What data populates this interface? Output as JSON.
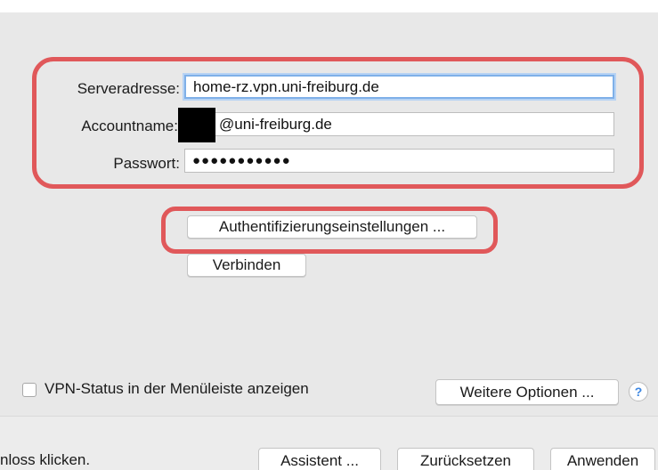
{
  "form": {
    "server_label": "Serveradresse:",
    "server_value": "home-rz.vpn.uni-freiburg.de",
    "account_label": "Accountname:",
    "account_value": "@uni-freiburg.de",
    "password_label": "Passwort:",
    "password_value": "●●●●●●●●●●●"
  },
  "buttons": {
    "auth_settings": "Authentifizierungseinstellungen ...",
    "connect": "Verbinden",
    "more_options": "Weitere Optionen ...",
    "assistant": "Assistent ...",
    "reset": "Zurücksetzen",
    "apply": "Anwenden"
  },
  "options": {
    "vpn_status_label": "VPN-Status in der Menüleiste anzeigen",
    "vpn_status_checked": false,
    "help_symbol": "?"
  },
  "footer": {
    "lock_text": "nloss klicken."
  },
  "colors": {
    "annotation": "#e0585a",
    "focus": "#7fb0e8",
    "help_blue": "#3b86e2"
  },
  "icons": {
    "help": "help-icon",
    "checkbox": "checkbox-icon"
  }
}
